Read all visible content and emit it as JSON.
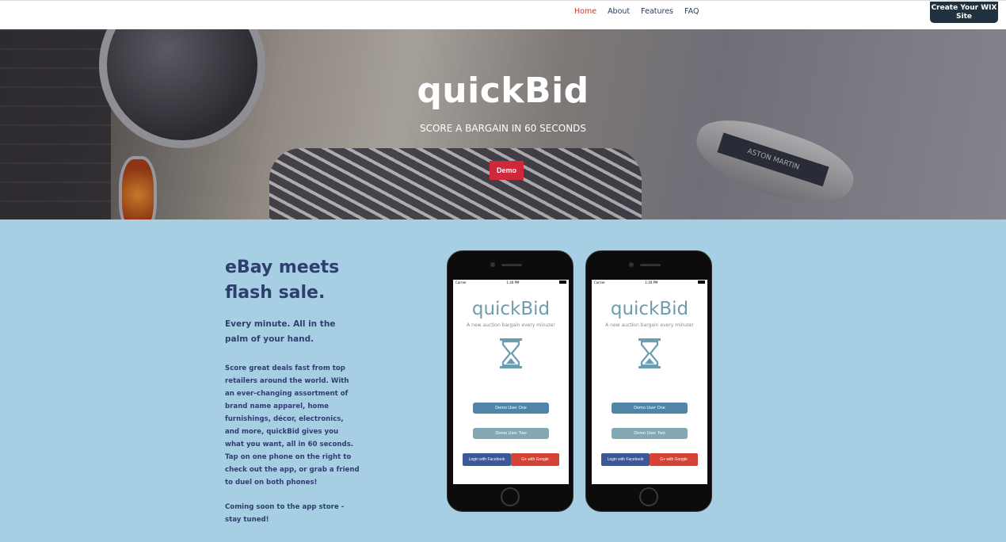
{
  "nav": {
    "items": [
      {
        "label": "Home",
        "active": true
      },
      {
        "label": "About",
        "active": false
      },
      {
        "label": "Features",
        "active": false
      },
      {
        "label": "FAQ",
        "active": false
      }
    ],
    "wix_badge": "Create Your WIX Site"
  },
  "hero": {
    "title": "quickBid",
    "subtitle": "SCORE A BARGAIN IN 60 SECONDS",
    "demo_label": "Demo",
    "emblem_text": "ASTON MARTIN",
    "demo_color": "#d0283a"
  },
  "content": {
    "headline": "eBay meets flash sale.",
    "lead": "Every minute. All in the palm of your hand.",
    "body": "Score great deals fast from top retailers around the world. With an ever-changing assortment of brand name apparel, home furnishings, décor, electronics, and more, quickBid gives you what you want, all in 60 seconds. Tap on one phone on the right to check out the app, or grab a friend to duel on both phones!",
    "coming_soon": "Coming soon to the app store - stay tuned!"
  },
  "phones": [
    {
      "status_left": "Carrier",
      "status_time": "1:30 PM",
      "app_title": "quickBid",
      "app_subtitle": "A new auction bargain every minute!",
      "btn_user_one": "Demo User One",
      "btn_user_two": "Demo User Two",
      "btn_facebook": "Login with Facebook",
      "btn_google": "G+ with Google"
    },
    {
      "status_left": "Carrier",
      "status_time": "1:30 PM",
      "app_title": "quickBid",
      "app_subtitle": "A new auction bargain every minute!",
      "btn_user_one": "Demo User One",
      "btn_user_two": "Demo User Two",
      "btn_facebook": "Login with Facebook",
      "btn_google": "G+ with Google"
    }
  ],
  "colors": {
    "page_bg": "#a6cfe3",
    "heading": "#2f3e6e",
    "nav_active": "#c0392b"
  }
}
